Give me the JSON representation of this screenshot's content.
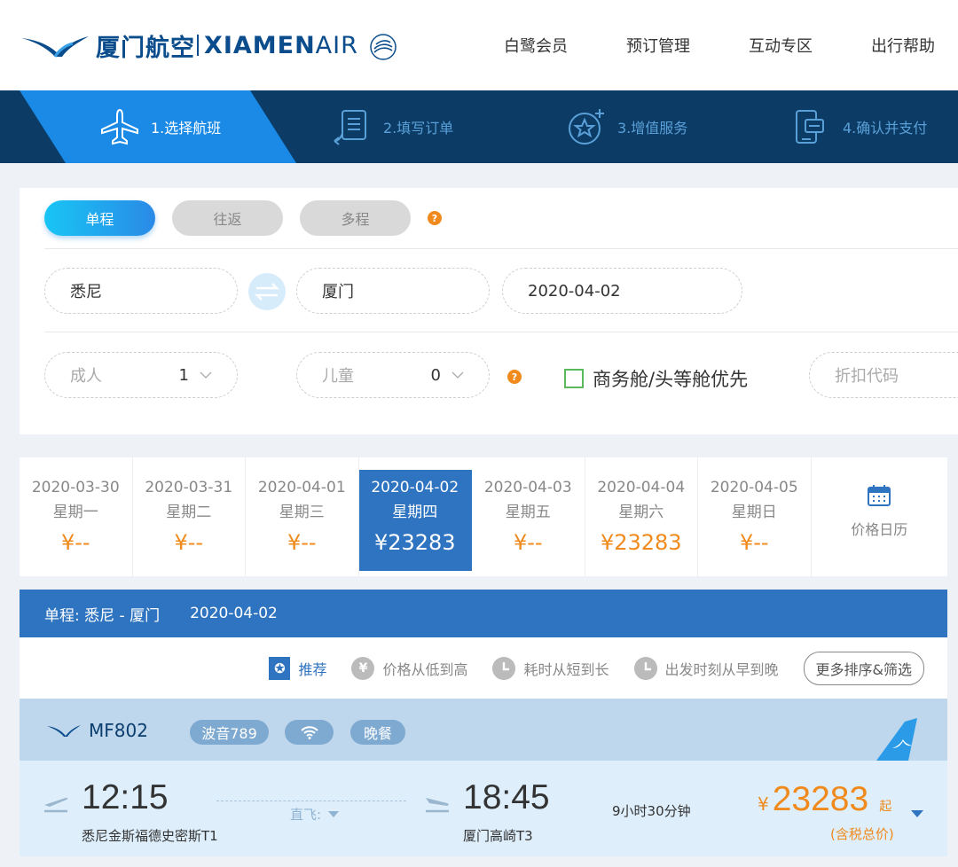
{
  "header": {
    "logo_cn": "厦门航空",
    "logo_en_bold": "XIAMEN",
    "logo_en_light": "AIR",
    "nav": [
      "白鹭会员",
      "预订管理",
      "互动专区",
      "出行帮助"
    ]
  },
  "steps": [
    {
      "label": "1.选择航班",
      "icon": "plane-icon",
      "active": true
    },
    {
      "label": "2.填写订单",
      "icon": "form-icon",
      "active": false
    },
    {
      "label": "3.增值服务",
      "icon": "star-service-icon",
      "active": false
    },
    {
      "label": "4.确认并支付",
      "icon": "phone-pay-icon",
      "active": false
    }
  ],
  "search": {
    "trip_types": [
      "单程",
      "往返",
      "多程"
    ],
    "help_mark": "?",
    "from": "悉尼",
    "to": "厦门",
    "date": "2020-04-02",
    "adult_label": "成人",
    "adult_count": "1",
    "child_label": "儿童",
    "child_count": "0",
    "business_first_label": "商务舱/头等舱优先",
    "discount_placeholder": "折扣代码"
  },
  "date_strip": [
    {
      "date": "2020-03-30",
      "weekday": "星期一",
      "price": "¥--"
    },
    {
      "date": "2020-03-31",
      "weekday": "星期二",
      "price": "¥--"
    },
    {
      "date": "2020-04-01",
      "weekday": "星期三",
      "price": "¥--"
    },
    {
      "date": "2020-04-02",
      "weekday": "星期四",
      "price": "¥23283"
    },
    {
      "date": "2020-04-03",
      "weekday": "星期五",
      "price": "¥--"
    },
    {
      "date": "2020-04-04",
      "weekday": "星期六",
      "price": "¥23283"
    },
    {
      "date": "2020-04-05",
      "weekday": "星期日",
      "price": "¥--"
    }
  ],
  "calendar_label": "价格日历",
  "route": {
    "label": "单程: 悉尼 - 厦门",
    "date": "2020-04-02"
  },
  "sort": {
    "recommend": "推荐",
    "price": "价格从低到高",
    "duration": "耗时从短到长",
    "depart": "出发时刻从早到晚",
    "more": "更多排序&筛选",
    "price_icon": "¥"
  },
  "flight": {
    "number": "MF802",
    "aircraft": "波音789",
    "meal": "晚餐",
    "depart_time": "12:15",
    "depart_airport": "悉尼金斯福德史密斯T1",
    "direct": "直飞:",
    "arrive_time": "18:45",
    "arrive_airport": "厦门高崎T3",
    "duration": "9小时30分钟",
    "price_currency": "¥",
    "price": "23283",
    "price_suffix": "起",
    "tax_note": "(含税总价)"
  },
  "colors": {
    "brand_dark": "#0c3c66",
    "brand_blue": "#2f74c0",
    "accent_orange": "#f08a1d"
  }
}
